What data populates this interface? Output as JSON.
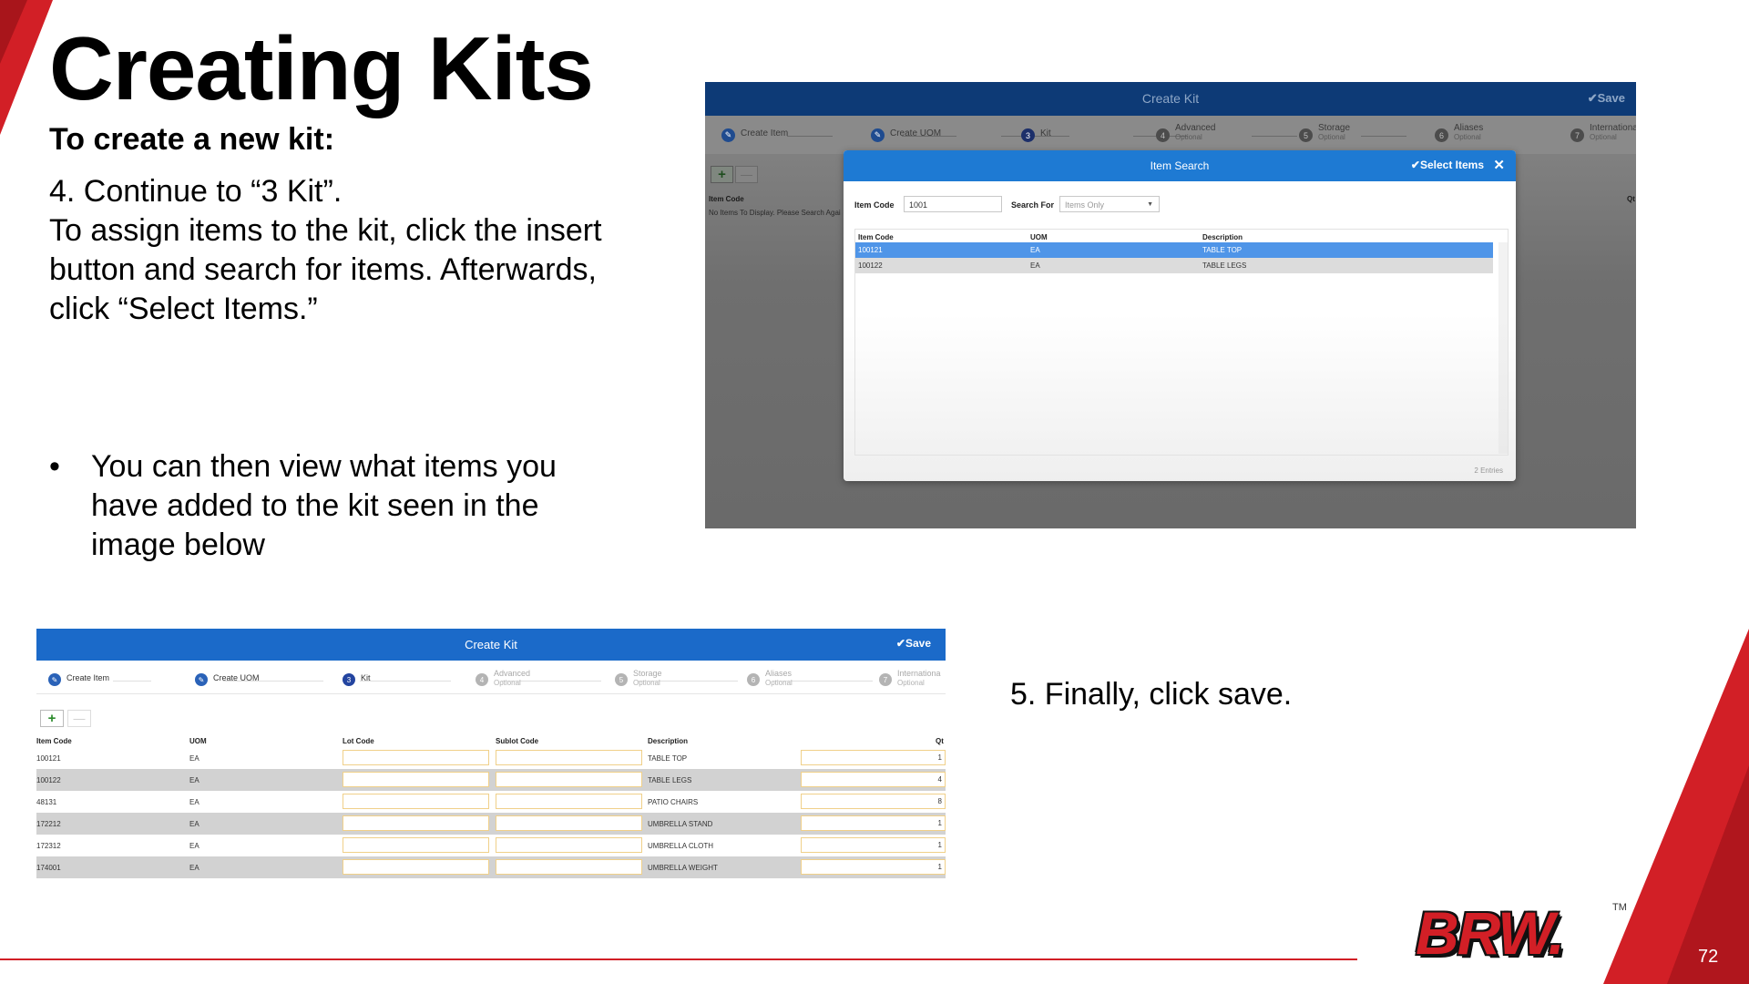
{
  "slide": {
    "title": "Creating Kits",
    "subtitle": "To create a new kit:",
    "step4": "4. Continue to “3 Kit”.\nTo assign items to the kit, click the insert button and search for items. Afterwards, click “Select Items.”",
    "bullet_marker": "•",
    "bullet": "You can then view what items you have added to the kit seen in the image below",
    "step5": "5. Finally, click save.",
    "page_number": "72",
    "logo_text": "BRW.",
    "logo_tm": "TM",
    "accent_color": "#d21f26"
  },
  "create_kit_search": {
    "header_title": "Create Kit",
    "save_label": "✔Save",
    "steps": [
      {
        "num": "",
        "label": "Create Item",
        "sub": ""
      },
      {
        "num": "",
        "label": "Create UOM",
        "sub": ""
      },
      {
        "num": "3",
        "label": "Kit",
        "sub": ""
      },
      {
        "num": "4",
        "label": "Advanced",
        "sub": "Optional"
      },
      {
        "num": "5",
        "label": "Storage",
        "sub": "Optional"
      },
      {
        "num": "6",
        "label": "Aliases",
        "sub": "Optional"
      },
      {
        "num": "7",
        "label": "Internationa",
        "sub": "Optional"
      }
    ],
    "add_icon": "+",
    "remove_icon": "—",
    "column_item_code": "Item Code",
    "column_qty": "Qt",
    "empty_message": "No Items To Display. Please Search Agai",
    "modal": {
      "title": "Item Search",
      "select_items_label": "✔Select Items",
      "close_icon": "✕",
      "item_code_label": "Item Code",
      "item_code_value": "1001",
      "search_for_label": "Search For",
      "search_for_value": "Items Only",
      "columns": [
        "Item Code",
        "UOM",
        "Description"
      ],
      "rows": [
        {
          "code": "100121",
          "uom": "EA",
          "desc": "TABLE TOP"
        },
        {
          "code": "100122",
          "uom": "EA",
          "desc": "TABLE LEGS"
        }
      ],
      "entries": "2 Entries",
      "selected_row_color": "#4f95e8",
      "header_color": "#1e7ad3"
    }
  },
  "create_kit_result": {
    "header_title": "Create Kit",
    "save_label": "✔Save",
    "steps": [
      {
        "num": "",
        "label": "Create Item",
        "sub": ""
      },
      {
        "num": "",
        "label": "Create UOM",
        "sub": ""
      },
      {
        "num": "3",
        "label": "Kit",
        "sub": ""
      },
      {
        "num": "4",
        "label": "Advanced",
        "sub": "Optional"
      },
      {
        "num": "5",
        "label": "Storage",
        "sub": "Optional"
      },
      {
        "num": "6",
        "label": "Aliases",
        "sub": "Optional"
      },
      {
        "num": "7",
        "label": "Internationa",
        "sub": "Optional"
      }
    ],
    "add_icon": "+",
    "remove_icon": "—",
    "columns": [
      "Item Code",
      "UOM",
      "Lot Code",
      "Sublot Code",
      "Description",
      "Qt"
    ],
    "rows": [
      {
        "code": "100121",
        "uom": "EA",
        "desc": "TABLE TOP",
        "qty": "1"
      },
      {
        "code": "100122",
        "uom": "EA",
        "desc": "TABLE LEGS",
        "qty": "4"
      },
      {
        "code": "48131",
        "uom": "EA",
        "desc": "PATIO CHAIRS",
        "qty": "8"
      },
      {
        "code": "172212",
        "uom": "EA",
        "desc": "UMBRELLA STAND",
        "qty": "1"
      },
      {
        "code": "172312",
        "uom": "EA",
        "desc": "UMBRELLA CLOTH",
        "qty": "1"
      },
      {
        "code": "174001",
        "uom": "EA",
        "desc": "UMBRELLA WEIGHT",
        "qty": "1"
      }
    ],
    "header_color": "#1b6ac9"
  }
}
